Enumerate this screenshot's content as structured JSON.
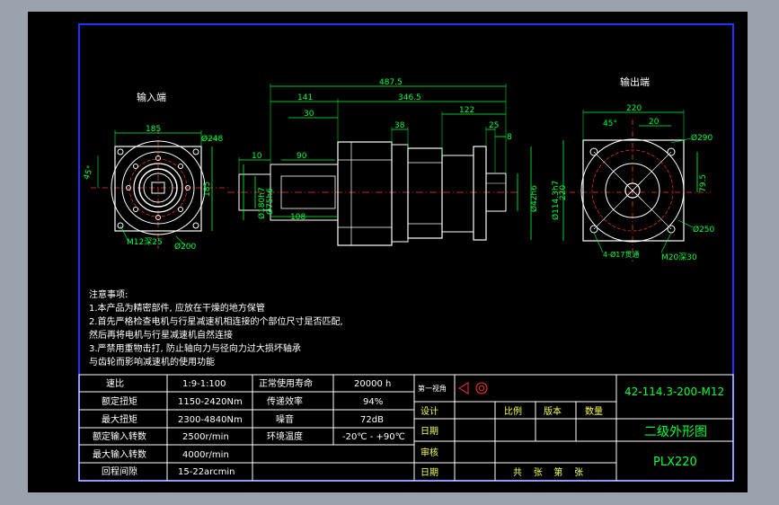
{
  "colors": {
    "background": "#9aa3ad",
    "sheet": "#000000",
    "frame": "#2233ff",
    "outline": "#ffffff",
    "dimension": "#00ff3c",
    "centerline": "#ff3333",
    "table_text": "#ffffff",
    "title_text": "#00ff3c",
    "notes_text": "#ffffff"
  },
  "views": {
    "input_label": "输入端",
    "output_label": "输出端"
  },
  "dimensions": {
    "input": {
      "width_185": "185",
      "height_185": "185",
      "dia_248": "Ø248",
      "angle_45": "45°",
      "hole_note": "M12深25",
      "dia_200": "Ø200"
    },
    "side": {
      "overall": "487.5",
      "d141": "141",
      "d346": "346.5",
      "d30": "30",
      "d122": "122",
      "d38": "38",
      "d25": "25",
      "d8": "8",
      "d10": "10",
      "d90": "90",
      "d108": "108",
      "dia180": "Ø180h7",
      "dia75": "Ø75h6",
      "dia42": "Ø42h6",
      "dia114": "Ø114.3h7"
    },
    "output": {
      "width_220": "220",
      "d20": "20",
      "angle_45": "45°",
      "dia_290": "Ø290",
      "height_220": "220",
      "d79": "79.5",
      "dia_250": "Ø250",
      "hole_note": "4-Ø17贯通",
      "tap_note": "M20深30"
    }
  },
  "notes": {
    "title": "注意事项:",
    "lines": [
      "1.本产品为精密部件, 应放在干燥的地方保管",
      "2.首先严格检查电机与行星减速机相连接的个部位尺寸是否匹配,",
      "然后再将电机与行星减速机自然连接",
      "3.严禁用重物击打, 防止轴向力与径向力过大损坏轴承",
      "与齿轮而影响减速机的使用功能"
    ]
  },
  "spec_table": {
    "rows": [
      [
        "速比",
        "1:9-1:100",
        "正常使用寿命",
        "20000 h"
      ],
      [
        "额定扭矩",
        "1150-2420Nm",
        "传递效率",
        "94%"
      ],
      [
        "最大扭矩",
        "2300-4840Nm",
        "噪音",
        "72dB"
      ],
      [
        "额定输入转数",
        "2500r/min",
        "环境温度",
        "-20℃ - +90℃"
      ],
      [
        "最大输入转数",
        "4000r/min",
        "",
        ""
      ],
      [
        "回程间隙",
        "15-22arcmin",
        "",
        ""
      ]
    ]
  },
  "title_block": {
    "projection_label": "第一视角",
    "design": "设计",
    "date1": "日期",
    "review": "审核",
    "date2": "日期",
    "scale": "比例",
    "version": "版本",
    "quantity": "数量",
    "sheets": "共    张    第    张",
    "drawing_no": "42-114.3-200-M12",
    "drawing_name": "二级外形图",
    "model": "PLX220"
  }
}
